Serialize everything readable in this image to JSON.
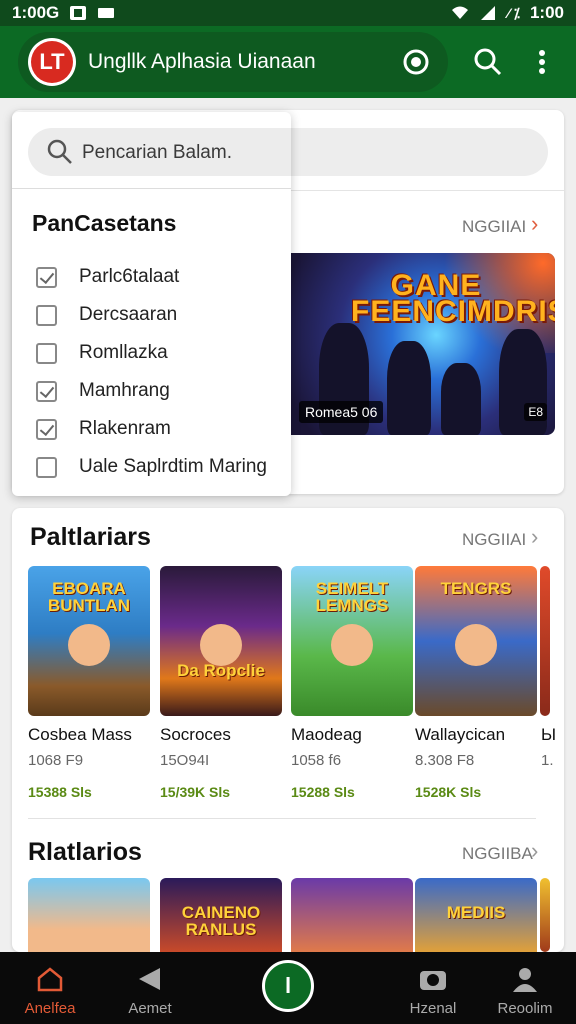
{
  "status_bar": {
    "time_left": "1:00G",
    "time_right": "1:00"
  },
  "app_bar": {
    "title": "Ungllk Aplhasia Uianaan",
    "logo_text": "LT"
  },
  "search": {
    "placeholder": "Pencarian Balam."
  },
  "categories_panel": {
    "title": "PanCasetans",
    "items": [
      {
        "label": "Parlc6talaat",
        "checked": true
      },
      {
        "label": "Dercsaaran",
        "checked": false
      },
      {
        "label": "Romllazka",
        "checked": false
      },
      {
        "label": "Mamhrang",
        "checked": true
      },
      {
        "label": "Rlakenram",
        "checked": true
      },
      {
        "label": "Uale Saplrdtim Maring",
        "checked": false
      }
    ]
  },
  "featured": {
    "more_label": "NGGIIAI",
    "banner_title": "GANE FEENCIMDRIS",
    "banner_chip": "Romea5 06",
    "banner_chip2": "E8"
  },
  "popular": {
    "title": "Paltlariars",
    "more_label": "NGGIIAI",
    "games": [
      {
        "name": "Cosbea Mass",
        "sub": "1068 F9",
        "downloads": "15388 Sls",
        "art": "EBOARA BUNTLAN"
      },
      {
        "name": "Socroces",
        "sub": "15O94I",
        "downloads": "15/39K Sls",
        "art": "Da Ropclie"
      },
      {
        "name": "Maodeag",
        "sub": "1058 f6",
        "downloads": "15288 Sls",
        "art": "SEIMELT LEMNGS"
      },
      {
        "name": "Wallaycican",
        "sub": "8.308 F8",
        "downloads": "1528K Sls",
        "art": "TENGRS"
      }
    ],
    "edge_name": "Ы",
    "edge_sub": "1."
  },
  "recommended": {
    "title": "Rlatlarios",
    "more_label": "NGGIIBA",
    "games": [
      {
        "art": ""
      },
      {
        "art": "CAINENO RANLUS"
      },
      {
        "art": ""
      },
      {
        "art": "MEDIIS"
      }
    ]
  },
  "bottom_nav": {
    "items": [
      {
        "label": "Anelfea",
        "icon": "home-icon"
      },
      {
        "label": "Aemet",
        "icon": "play-icon"
      },
      {
        "label": "Hzenal",
        "icon": "camera-icon"
      },
      {
        "label": "Reoolim",
        "icon": "profile-icon"
      }
    ],
    "center_label": "l"
  },
  "colors": {
    "primary_green": "#0c6a24",
    "status_bar": "#0f4a1c",
    "download_green": "#5a8a14",
    "active_nav": "#e25a36"
  }
}
